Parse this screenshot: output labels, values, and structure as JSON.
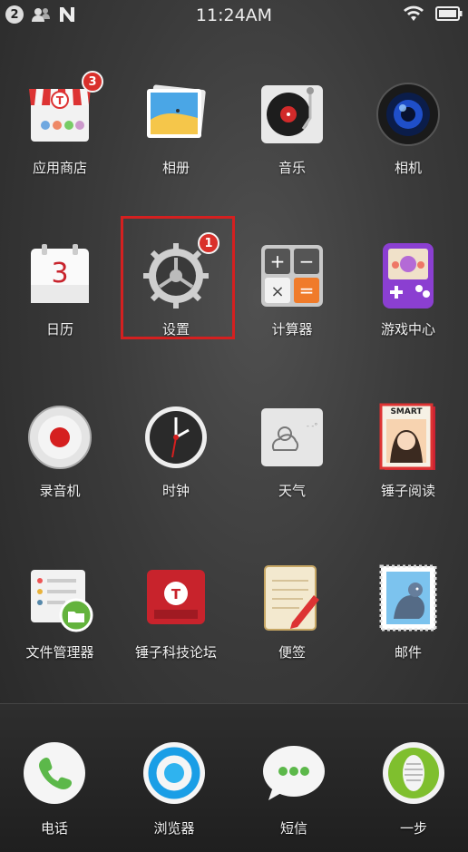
{
  "status_bar": {
    "notification_count": "2",
    "time": "11:24AM",
    "icons": [
      "notification-count-icon",
      "contacts-icon",
      "n-logo-icon",
      "wifi-icon",
      "battery-icon"
    ]
  },
  "apps": [
    {
      "label": "应用商店",
      "icon": "app-store-icon",
      "badge": "3"
    },
    {
      "label": "相册",
      "icon": "gallery-icon"
    },
    {
      "label": "音乐",
      "icon": "music-icon"
    },
    {
      "label": "相机",
      "icon": "camera-icon"
    },
    {
      "label": "日历",
      "icon": "calendar-icon",
      "calendar_day": "3"
    },
    {
      "label": "设置",
      "icon": "settings-icon",
      "badge": "1"
    },
    {
      "label": "计算器",
      "icon": "calculator-icon"
    },
    {
      "label": "游戏中心",
      "icon": "game-center-icon"
    },
    {
      "label": "录音机",
      "icon": "recorder-icon"
    },
    {
      "label": "时钟",
      "icon": "clock-icon"
    },
    {
      "label": "天气",
      "icon": "weather-icon"
    },
    {
      "label": "锤子阅读",
      "icon": "smart-reader-icon",
      "icon_text": "SMART"
    },
    {
      "label": "文件管理器",
      "icon": "file-manager-icon"
    },
    {
      "label": "锤子科技论坛",
      "icon": "forum-icon"
    },
    {
      "label": "便签",
      "icon": "notes-icon"
    },
    {
      "label": "邮件",
      "icon": "mail-icon"
    }
  ],
  "dock": [
    {
      "label": "电话",
      "icon": "phone-icon"
    },
    {
      "label": "浏览器",
      "icon": "browser-icon"
    },
    {
      "label": "短信",
      "icon": "sms-icon"
    },
    {
      "label": "一步",
      "icon": "one-step-icon"
    }
  ],
  "colors": {
    "badge": "#d9302b",
    "highlight": "#d42020",
    "calendar_red": "#c8232c",
    "game_purple": "#8b3fd1"
  }
}
